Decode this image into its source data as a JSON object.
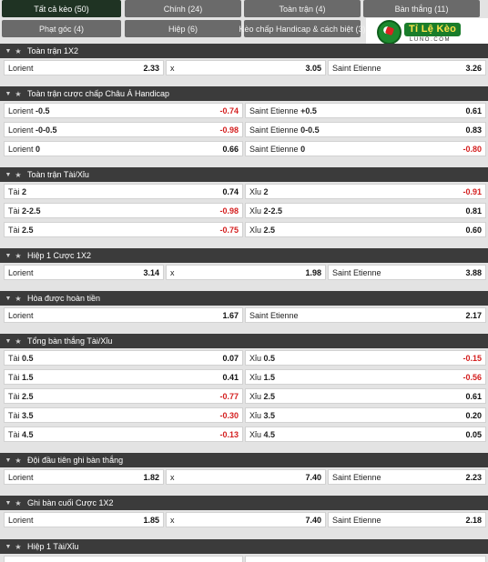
{
  "tabs": [
    {
      "label": "Tất cả kèo (50)",
      "active": true
    },
    {
      "label": "Chính (24)"
    },
    {
      "label": "Toàn trận (4)"
    },
    {
      "label": "Bàn thắng (11)"
    },
    {
      "label": "Phạt góc (4)"
    },
    {
      "label": "Hiệp (6)"
    },
    {
      "label": "Kèo chấp Handicap & cách biệt (3)"
    }
  ],
  "logo": {
    "brand": "Tỉ Lệ Kèo",
    "sub": "LUNO.COM"
  },
  "sections": [
    {
      "title": "Toàn trận 1X2",
      "rows": [
        [
          {
            "label": "Lorient",
            "odd": "2.33"
          },
          {
            "label": "x",
            "odd": "3.05"
          },
          {
            "label": "Saint Etienne",
            "odd": "3.26"
          }
        ]
      ]
    },
    {
      "title": "Toàn trận cược chấp Châu Á Handicap",
      "rows": [
        [
          {
            "label": "Lorient",
            "line": "-0.5",
            "odd": "-0.74",
            "neg": true
          },
          {
            "label": "Saint Etienne",
            "line": "+0.5",
            "odd": "0.61"
          }
        ],
        [
          {
            "label": "Lorient",
            "line": "-0-0.5",
            "odd": "-0.98",
            "neg": true
          },
          {
            "label": "Saint Etienne",
            "line": "0-0.5",
            "odd": "0.83"
          }
        ],
        [
          {
            "label": "Lorient",
            "line": "0",
            "odd": "0.66"
          },
          {
            "label": "Saint Etienne",
            "line": "0",
            "odd": "-0.80",
            "neg": true
          }
        ]
      ]
    },
    {
      "title": "Toàn trận Tài/Xỉu",
      "rows": [
        [
          {
            "label": "Tài",
            "line": "2",
            "odd": "0.74"
          },
          {
            "label": "Xỉu",
            "line": "2",
            "odd": "-0.91",
            "neg": true
          }
        ],
        [
          {
            "label": "Tài",
            "line": "2-2.5",
            "odd": "-0.98",
            "neg": true
          },
          {
            "label": "Xỉu",
            "line": "2-2.5",
            "odd": "0.81"
          }
        ],
        [
          {
            "label": "Tài",
            "line": "2.5",
            "odd": "-0.75",
            "neg": true
          },
          {
            "label": "Xỉu",
            "line": "2.5",
            "odd": "0.60"
          }
        ]
      ]
    },
    {
      "title": "Hiệp 1 Cược 1X2",
      "rows": [
        [
          {
            "label": "Lorient",
            "odd": "3.14"
          },
          {
            "label": "x",
            "odd": "1.98"
          },
          {
            "label": "Saint Etienne",
            "odd": "3.88"
          }
        ]
      ]
    },
    {
      "title": "Hòa được hoàn tiền",
      "rows": [
        [
          {
            "label": "Lorient",
            "odd": "1.67"
          },
          {
            "label": "Saint Etienne",
            "odd": "2.17"
          }
        ]
      ]
    },
    {
      "title": "Tổng bàn thắng Tài/Xỉu",
      "rows": [
        [
          {
            "label": "Tài",
            "line": "0.5",
            "odd": "0.07"
          },
          {
            "label": "Xỉu",
            "line": "0.5",
            "odd": "-0.15",
            "neg": true
          }
        ],
        [
          {
            "label": "Tài",
            "line": "1.5",
            "odd": "0.41"
          },
          {
            "label": "Xỉu",
            "line": "1.5",
            "odd": "-0.56",
            "neg": true
          }
        ],
        [
          {
            "label": "Tài",
            "line": "2.5",
            "odd": "-0.77",
            "neg": true
          },
          {
            "label": "Xỉu",
            "line": "2.5",
            "odd": "0.61"
          }
        ],
        [
          {
            "label": "Tài",
            "line": "3.5",
            "odd": "-0.30",
            "neg": true
          },
          {
            "label": "Xỉu",
            "line": "3.5",
            "odd": "0.20"
          }
        ],
        [
          {
            "label": "Tài",
            "line": "4.5",
            "odd": "-0.13",
            "neg": true
          },
          {
            "label": "Xỉu",
            "line": "4.5",
            "odd": "0.05"
          }
        ]
      ]
    },
    {
      "title": "Đội đầu tiên ghi bàn thắng",
      "rows": [
        [
          {
            "label": "Lorient",
            "odd": "1.82"
          },
          {
            "label": "x",
            "odd": "7.40"
          },
          {
            "label": "Saint Etienne",
            "odd": "2.23"
          }
        ]
      ]
    },
    {
      "title": "Ghi bàn cuối Cược 1X2",
      "rows": [
        [
          {
            "label": "Lorient",
            "odd": "1.85"
          },
          {
            "label": "x",
            "odd": "7.40"
          },
          {
            "label": "Saint Etienne",
            "odd": "2.18"
          }
        ]
      ]
    },
    {
      "title": "Hiệp 1 Tài/Xỉu",
      "rows": [
        [
          {
            "label": "",
            "odd": ""
          },
          {
            "label": "",
            "odd": ""
          }
        ]
      ]
    }
  ],
  "icons": {
    "collapse": "chevron-down-icon",
    "favorite": "star-icon"
  },
  "colors": {
    "active_tab": "#1f3323",
    "tab": "#6a6a6a",
    "section_header": "#3b3b3b",
    "negative_odd": "#d42020"
  }
}
